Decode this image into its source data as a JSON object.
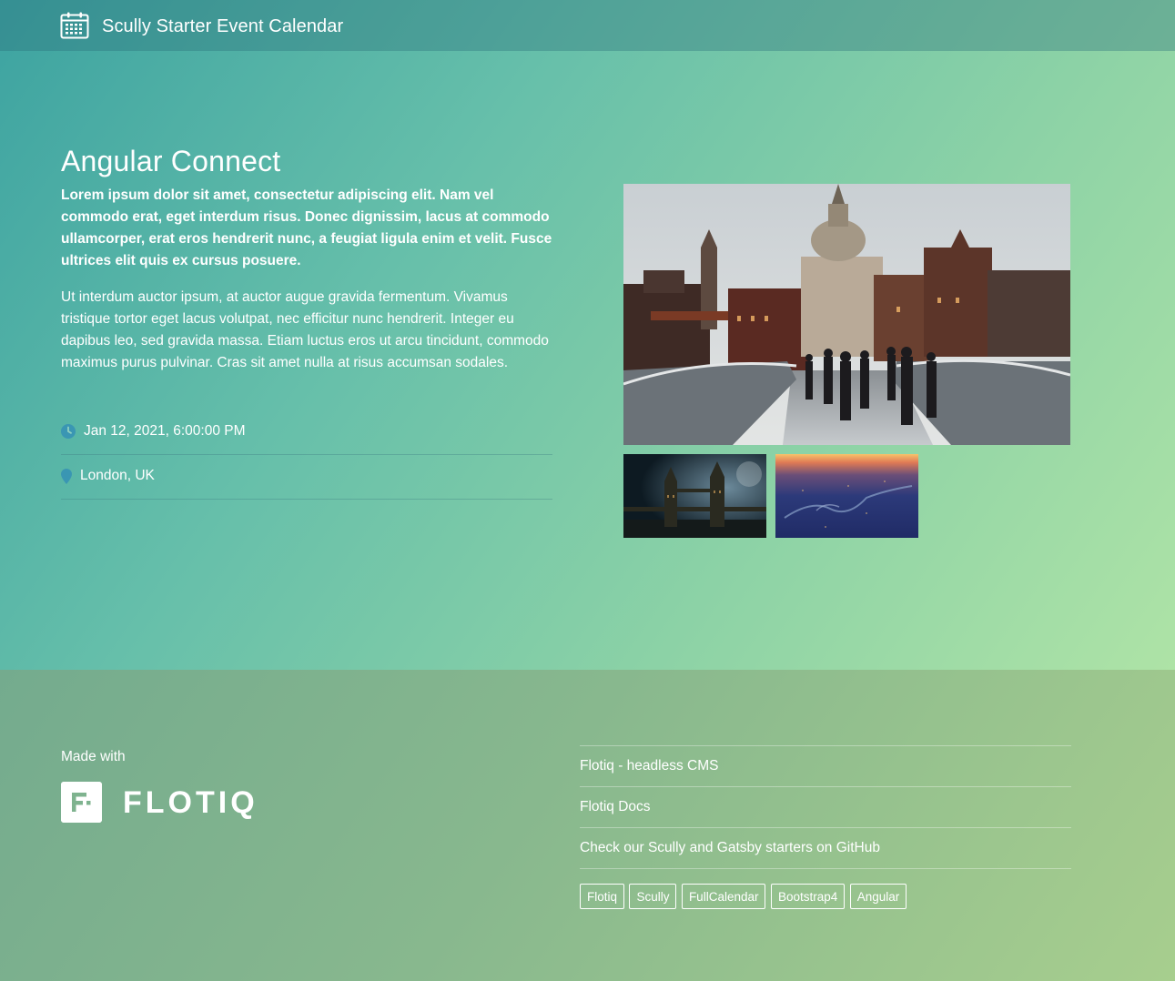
{
  "header": {
    "app_title": "Scully Starter Event Calendar",
    "logo_icon": "calendar-icon"
  },
  "event": {
    "title": "Angular Connect",
    "lead": "Lorem ipsum dolor sit amet, consectetur adipiscing elit. Nam vel commodo erat, eget interdum risus. Donec dignissim, lacus at commodo ullamcorper, erat eros hendrerit nunc, a feugiat ligula enim et velit. Fusce ultrices elit quis ex cursus posuere.",
    "body": "Ut interdum auctor ipsum, at auctor augue gravida fermentum. Vivamus tristique tortor eget lacus volutpat, nec efficitur nunc hendrerit. Integer eu dapibus leo, sed gravida massa. Etiam luctus eros ut arcu tincidunt, commodo maximus purus pulvinar. Cras sit amet nulla at risus accumsan sodales.",
    "date_icon": "clock-icon",
    "date": "Jan 12, 2021, 6:00:00 PM",
    "location_icon": "map-pin-icon",
    "location": "London, UK"
  },
  "gallery": {
    "main_photo": "london-st-pauls-millennium-bridge-photo",
    "thumbnails": [
      "tower-bridge-night-photo",
      "thames-aerial-sunset-photo"
    ]
  },
  "footer": {
    "made_with": "Made with",
    "brand": "FLOTIQ",
    "links": [
      "Flotiq - headless CMS",
      "Flotiq Docs",
      "Check our Scully and Gatsby starters on GitHub"
    ],
    "tags": [
      "Flotiq",
      "Scully",
      "FullCalendar",
      "Bootstrap4",
      "Angular"
    ]
  },
  "colors": {
    "accent_icon": "#3a96b3",
    "gradient_start": "#3da3a1",
    "gradient_end": "#aee3a6"
  }
}
